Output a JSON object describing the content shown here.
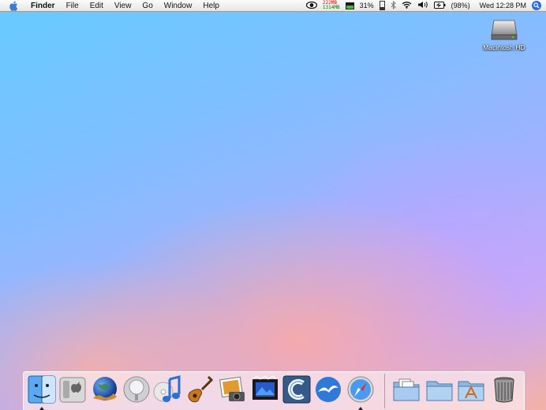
{
  "menubar": {
    "app_name": "Finder",
    "menus": [
      "File",
      "Edit",
      "View",
      "Go",
      "Window",
      "Help"
    ],
    "memory": {
      "used": "222MB",
      "free": "1314MB"
    },
    "cpu": "31%",
    "battery": "(98%)",
    "clock": "Wed 12:28 PM"
  },
  "desktop": {
    "hd_label": "Macintosh HD"
  },
  "dock": {
    "apps": [
      "finder-icon",
      "system-preferences-icon",
      "network-globe-icon",
      "quicktime-icon",
      "itunes-icon",
      "garageband-icon",
      "iphoto-icon",
      "imovie-icon",
      "app-c-icon",
      "seagull-icon",
      "safari-icon"
    ],
    "right": [
      "documents-folder-icon",
      "folder-icon",
      "applications-folder-icon",
      "trash-icon"
    ]
  }
}
